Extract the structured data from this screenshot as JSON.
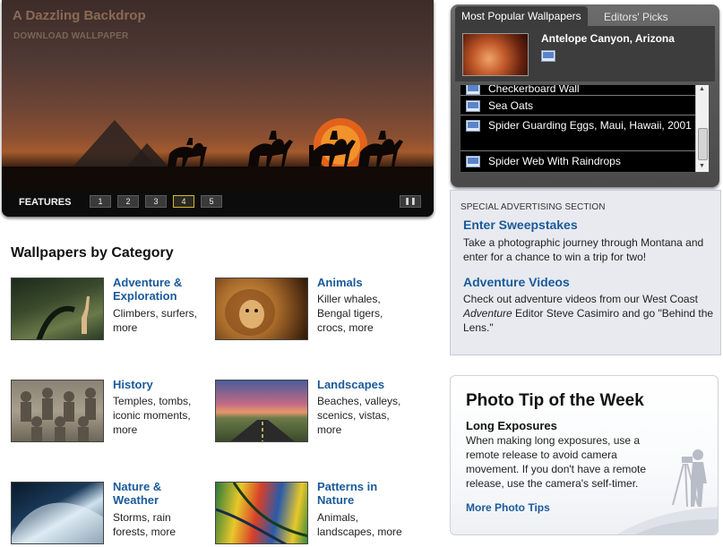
{
  "hero": {
    "title": "A Dazzling Backdrop",
    "download_label": "DOWNLOAD WALLPAPER",
    "features_label": "FEATURES",
    "pages": [
      "1",
      "2",
      "3",
      "4",
      "5"
    ],
    "active_page": "4",
    "pause_icon": "pause-icon"
  },
  "popular": {
    "tab_active": "Most Popular Wallpapers",
    "tab_inactive": "Editors' Picks",
    "top_item": "Antelope Canyon, Arizona",
    "list": [
      "Checkerboard Wall",
      "Sea Oats",
      "Spider Guarding Eggs, Maui, Hawaii, 2001",
      "Spider Web With Raindrops"
    ]
  },
  "ads": {
    "label": "SPECIAL ADVERTISING SECTION",
    "items": [
      {
        "heading": "Enter Sweepstakes",
        "body": "Take a photographic journey through Montana and enter for a chance to win a trip for two!"
      },
      {
        "heading": "Adventure Videos",
        "body_pre": "Check out adventure videos from our West Coast ",
        "body_em": "Adventure",
        "body_post": " Editor Steve Casimiro and go \"Behind the Lens.\""
      }
    ]
  },
  "tip": {
    "title": "Photo Tip of the Week",
    "subtitle": "Long Exposures",
    "body": "When making long exposures, use a remote release to avoid camera movement. If you don't have a remote release, use the camera's self-timer.",
    "link": "More Photo Tips"
  },
  "categories": {
    "title": "Wallpapers by Category",
    "items": [
      {
        "name_line1": "Adventure &",
        "name_line2": "Exploration",
        "desc1": "Climbers, surfers,",
        "desc2": "more",
        "desc3": ""
      },
      {
        "name_line1": "Animals",
        "name_line2": "",
        "desc1": "Killer whales,",
        "desc2": "Bengal tigers,",
        "desc3": "crocs, more"
      },
      {
        "name_line1": "History",
        "name_line2": "",
        "desc1": "Temples, tombs,",
        "desc2": "iconic moments,",
        "desc3": "more"
      },
      {
        "name_line1": "Landscapes",
        "name_line2": "",
        "desc1": "Beaches, valleys,",
        "desc2": "scenics, vistas,",
        "desc3": "more"
      },
      {
        "name_line1": "Nature &",
        "name_line2": "Weather",
        "desc1": "Storms, rain",
        "desc2": "forests, more",
        "desc3": ""
      },
      {
        "name_line1": "Patterns in",
        "name_line2": "Nature",
        "desc1": "Animals,",
        "desc2": "landscapes, more",
        "desc3": ""
      }
    ]
  },
  "colors": {
    "link_blue": "#1a5a9a",
    "active_page_border": "#d8b62a",
    "ad_background": "#e8eaf0"
  }
}
